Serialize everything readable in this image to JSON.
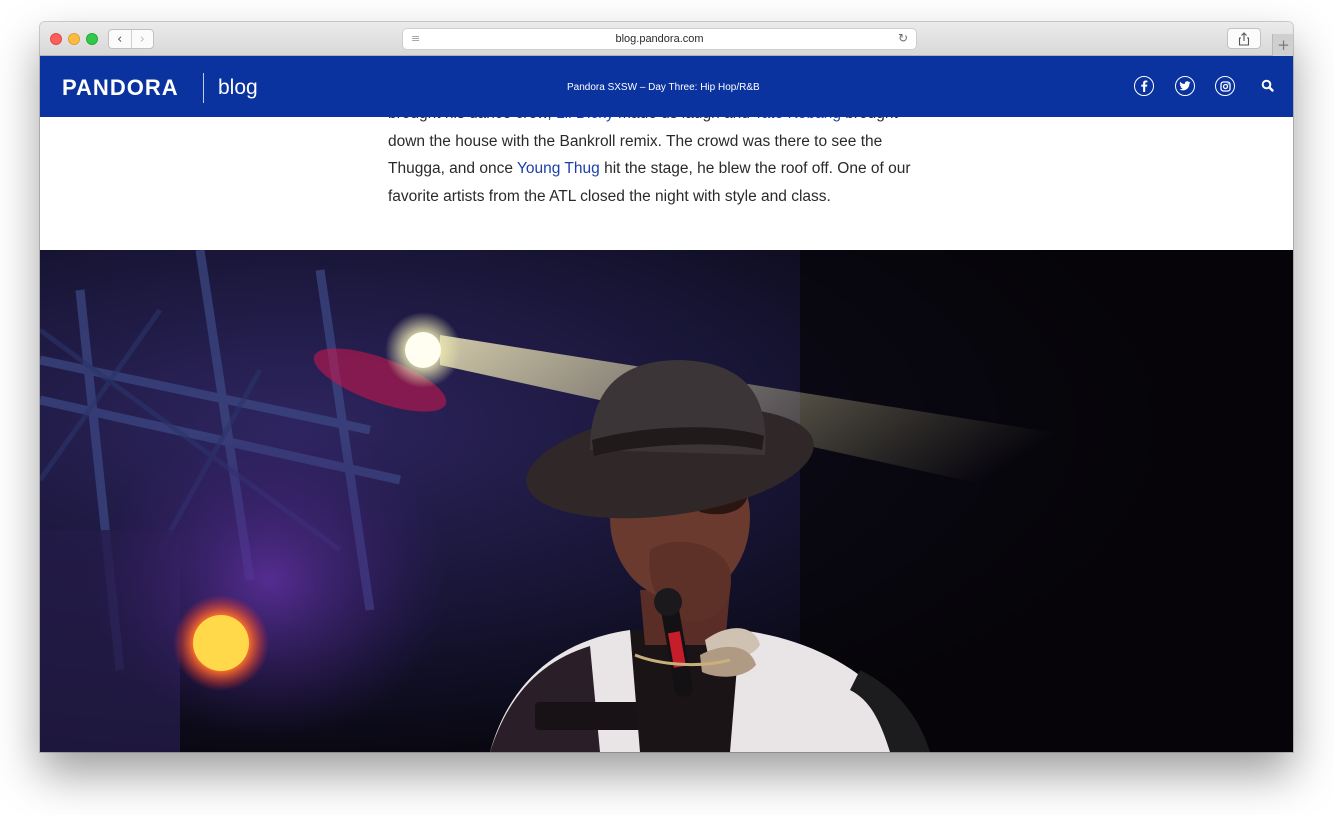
{
  "browser": {
    "url": "blog.pandora.com",
    "back_glyph": "‹",
    "forward_glyph": "›",
    "reader_glyph": "≡",
    "reload_glyph": "↻",
    "newtab_glyph": "+"
  },
  "site": {
    "logo": "PANDORA",
    "section": "blog",
    "headline": "Pandora SXSW – Day Three: Hip Hop/R&B",
    "social": [
      "facebook-icon",
      "twitter-icon",
      "instagram-icon"
    ],
    "brand_color": "#0a33a0",
    "link_color": "#1b3fa8"
  },
  "article": {
    "line1_a": "brought his dance crew, ",
    "link_lil_dicky": "Lil Dicky",
    "line1_b": " made us laugh and ",
    "link_tate_kobang": "Tate Kobang",
    "line1_c": " brought",
    "line2": "down the house with the Bankroll remix. The crowd was there to see the",
    "line3_a": "Thugga, and once ",
    "link_young_thug": "Young Thug",
    "line3_b": " hit the stage, he blew the roof off. One of our",
    "line4": "favorite artists from the ATL closed the night with style and class."
  }
}
